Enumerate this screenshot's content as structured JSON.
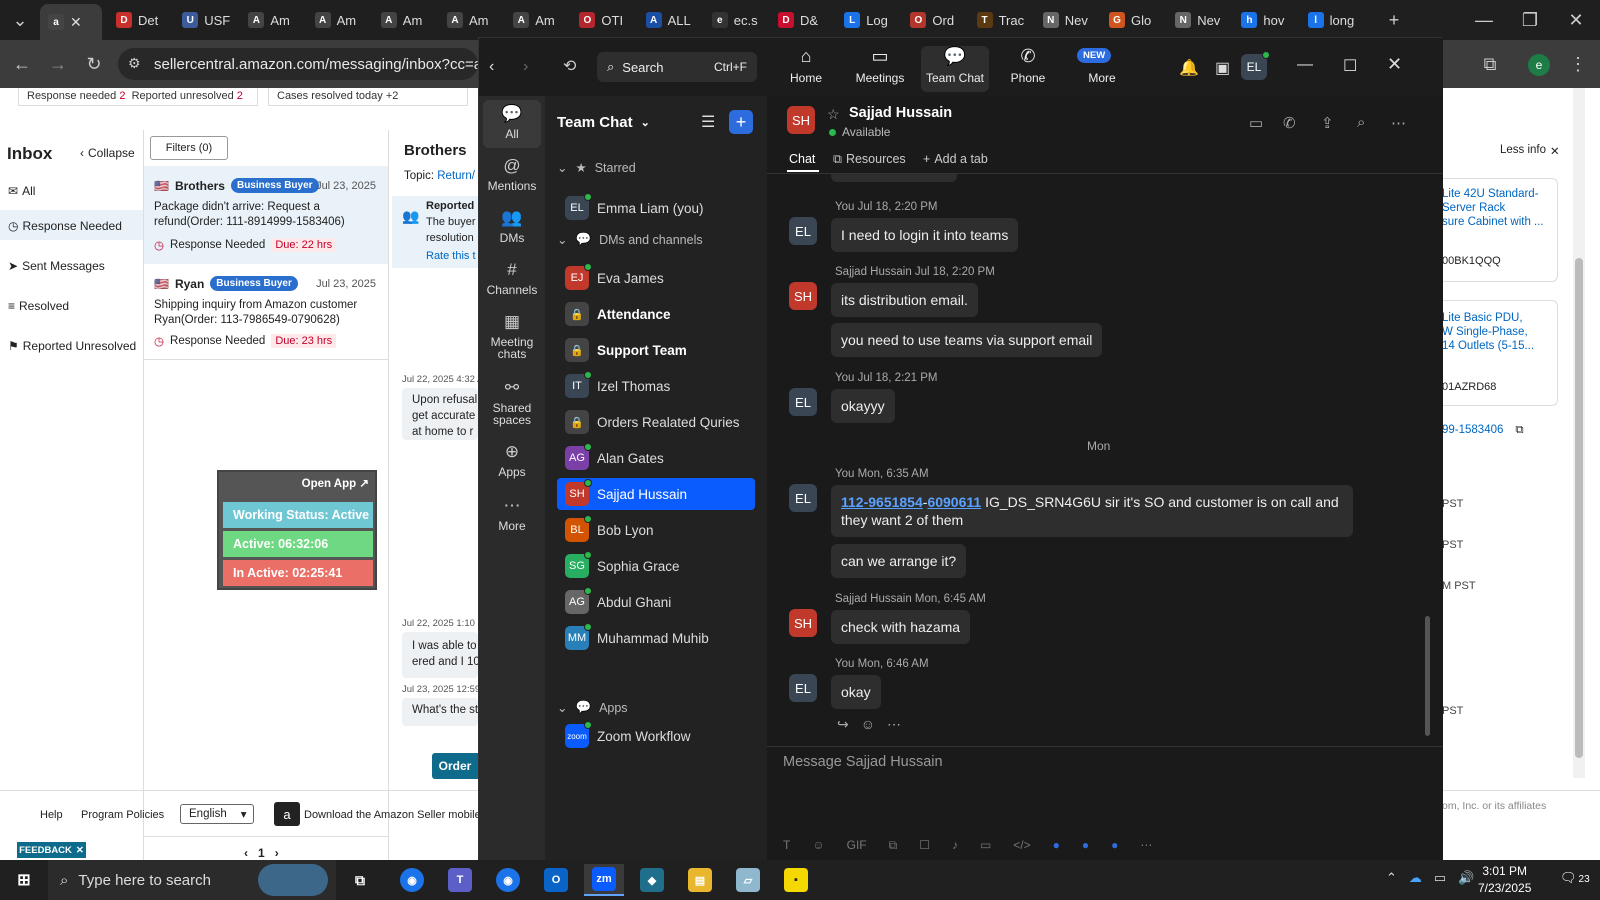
{
  "browser": {
    "tabs": [
      {
        "label": "Det",
        "icon": "store-icon",
        "color": "#c9302c"
      },
      {
        "label": "USF",
        "icon": "flag-icon",
        "color": "#3b5b9a"
      },
      {
        "label": "Am",
        "icon": "amazon-icon",
        "color": "#444"
      },
      {
        "label": "Am",
        "icon": "amazon-icon",
        "color": "#444"
      },
      {
        "label": "Am",
        "icon": "amazon-icon",
        "color": "#444"
      },
      {
        "label": "Am",
        "icon": "amazon-icon",
        "color": "#444"
      },
      {
        "label": "Am",
        "icon": "amazon-icon",
        "color": "#444"
      },
      {
        "label": "OTI",
        "icon": "truck-icon",
        "color": "#b3262c"
      },
      {
        "label": "ALL",
        "icon": "ti-icon",
        "color": "#1b4fa3"
      },
      {
        "label": "ec.s",
        "icon": "ec-icon",
        "color": "#333"
      },
      {
        "label": "D&",
        "icon": "dell-icon",
        "color": "#c8102e"
      },
      {
        "label": "Log",
        "icon": "google-icon",
        "color": "#1a73e8"
      },
      {
        "label": "Ord",
        "icon": "ord-icon",
        "color": "#b3352c"
      },
      {
        "label": "Trac",
        "icon": "ups-icon",
        "color": "#5b3a12"
      },
      {
        "label": "Nev",
        "icon": "globe-icon",
        "color": "#666"
      },
      {
        "label": "Glo",
        "icon": "glo-icon",
        "color": "#d0541f"
      },
      {
        "label": "Nev",
        "icon": "globe-icon",
        "color": "#666"
      },
      {
        "label": "hov",
        "icon": "google-icon",
        "color": "#1a73e8"
      },
      {
        "label": "long",
        "icon": "google-icon",
        "color": "#1a73e8"
      }
    ],
    "url": "sellercentral.amazon.com/messaging/inbox?cc=aa2",
    "profile_letter": "e"
  },
  "seller": {
    "stats": {
      "response_needed": "Response needed",
      "response_needed_n": "2",
      "reported_unresolved": "Reported unresolved",
      "reported_unresolved_n": "2",
      "cases_resolved": "Cases resolved today",
      "cases_resolved_n": "+2"
    },
    "inbox_title": "Inbox",
    "collapse": "Collapse",
    "filters": "Filters (0)",
    "nav": [
      "All",
      "Response Needed",
      "Sent Messages",
      "Resolved",
      "Reported Unresolved"
    ],
    "threads": [
      {
        "name": "Brothers",
        "badge": "Business Buyer",
        "date": "Jul 23, 2025",
        "subject": "Package didn't arrive: Request a refund(Order: 111-8914999-1583406)",
        "status": "Response Needed",
        "due": "Due: 22 hrs"
      },
      {
        "name": "Ryan",
        "badge": "Business Buyer",
        "date": "Jul 23, 2025",
        "subject": "Shipping inquiry from Amazon customer Ryan(Order: 113-7986549-0790628)",
        "status": "Response Needed",
        "due": "Due: 23 hrs"
      }
    ],
    "pager": "1",
    "conv_title": "Brothers",
    "topic_label": "Topic:",
    "topic": "Return/",
    "reported_title": "Reported",
    "reported_l1": "The buyer",
    "reported_l2": "resolution",
    "rate": "Rate this t",
    "msg1_time": "Jul 22, 2025 4:32 A",
    "msg1": [
      "Upon refusal",
      "get accurate",
      "at home to r"
    ],
    "msg2_time": "Jul 22, 2025 1:10 P",
    "msg2": [
      "I was able to",
      "ered and I 10"
    ],
    "msg3_time": "Jul 23, 2025 12:59",
    "msg3": "What's the st",
    "order_btn": "Order",
    "right_panel": {
      "less_info": "Less info",
      "p1": [
        "Lite 42U Standard-",
        "Server Rack",
        "sure Cabinet with ..."
      ],
      "p1_asin": "00BK1QQQ",
      "p2": [
        "Lite Basic PDU,",
        "W Single-Phase,",
        "14 Outlets (5-15..."
      ],
      "p2_asin": "01AZRD68",
      "order": "99-1583406",
      "pst": [
        "PST",
        "PST",
        "M PST",
        "PST"
      ],
      "copyright": "om, Inc. or its affiliates"
    },
    "footer": {
      "help": "Help",
      "policies": "Program Policies",
      "language": "English",
      "download": "Download the Amazon Seller mobile",
      "feedback": "FEEDBACK"
    }
  },
  "status_widget": {
    "open_app": "Open App",
    "working": "Working Status: Active",
    "active": "Active: 06:32:06",
    "inactive": "In Active: 02:25:41"
  },
  "zoom": {
    "search": "Search",
    "search_shortcut": "Ctrl+F",
    "nav": [
      {
        "label": "Home",
        "icon": "home-icon"
      },
      {
        "label": "Meetings",
        "icon": "video-icon"
      },
      {
        "label": "Team Chat",
        "icon": "chat-icon"
      },
      {
        "label": "Phone",
        "icon": "phone-icon"
      },
      {
        "label": "More",
        "icon": "more-icon"
      }
    ],
    "new_badge": "NEW",
    "user_initials": "EL",
    "rail": [
      {
        "label": "All",
        "icon": "chat-bubble-icon"
      },
      {
        "label": "Mentions",
        "icon": "at-icon"
      },
      {
        "label": "DMs",
        "icon": "people-icon"
      },
      {
        "label": "Channels",
        "icon": "hash-icon"
      },
      {
        "label": "Meeting chats",
        "icon": "calendar-icon"
      },
      {
        "label": "Shared spaces",
        "icon": "share-icon"
      },
      {
        "label": "Apps",
        "icon": "apps-icon"
      },
      {
        "label": "More",
        "icon": "ellipsis-icon"
      }
    ],
    "list_title": "Team Chat",
    "starred": "Starred",
    "dms_channels": "DMs and channels",
    "apps": "Apps",
    "contacts": [
      {
        "name": "Emma Liam (you)",
        "initials": "EL",
        "color": "#3a4654",
        "bold": false
      },
      {
        "name": "Eva James",
        "initials": "EJ",
        "color": "#c0392b",
        "bold": false
      },
      {
        "name": "Attendance",
        "initials": "🔒",
        "color": "#444",
        "bold": true
      },
      {
        "name": "Support Team",
        "initials": "🔒",
        "color": "#444",
        "bold": true
      },
      {
        "name": "Izel Thomas",
        "initials": "IT",
        "color": "#3a4654",
        "bold": false
      },
      {
        "name": "Orders Realated Quries",
        "initials": "🔒",
        "color": "#444",
        "bold": false
      },
      {
        "name": "Alan Gates",
        "initials": "AG",
        "color": "#7b3fa8",
        "bold": false
      },
      {
        "name": "Sajjad Hussain",
        "initials": "SH",
        "color": "#c0392b",
        "bold": false
      },
      {
        "name": "Bob Lyon",
        "initials": "BL",
        "color": "#d35400",
        "bold": false
      },
      {
        "name": "Sophia Grace",
        "initials": "SG",
        "color": "#27ae60",
        "bold": false
      },
      {
        "name": "Abdul Ghani",
        "initials": "AG",
        "color": "#666",
        "bold": false
      },
      {
        "name": "Muhammad Muhib",
        "initials": "MM",
        "color": "#2980b9",
        "bold": false
      }
    ],
    "app_item": {
      "name": "Zoom Workflow",
      "initials": "zoom"
    },
    "chat": {
      "contact_name": "Sajjad Hussain",
      "contact_initials": "SH",
      "presence": "Available",
      "tab_chat": "Chat",
      "tab_resources": "Resources",
      "tab_add": "Add a tab",
      "day_divider": "Mon",
      "messages": [
        {
          "who": "EL",
          "meta": "You Jul 18, 2:20 PM",
          "text": "I need to login it into teams"
        },
        {
          "who": "SH",
          "meta": "Sajjad Hussain Jul 18, 2:20 PM",
          "text": "its distribution email."
        },
        {
          "who": "",
          "meta": "",
          "text": "you need to use teams via support email"
        },
        {
          "who": "EL",
          "meta": "You Jul 18, 2:21 PM",
          "text": "okayyy"
        },
        {
          "who": "EL",
          "meta": "You Mon, 6:35 AM",
          "link1": "112-9651854",
          "link2": "6090611",
          "text": "IG_DS_SRN4G6U sir it's SO and customer is on call and they want 2 of them"
        },
        {
          "who": "",
          "meta": "",
          "text": "can we arrange it?"
        },
        {
          "who": "SH",
          "meta": "Sajjad Hussain Mon, 6:45 AM",
          "text": "check with hazama"
        },
        {
          "who": "EL",
          "meta": "You Mon, 6:46 AM",
          "text": "okay"
        }
      ],
      "compose_placeholder": "Message Sajjad Hussain"
    }
  },
  "taskbar": {
    "search_placeholder": "Type here to search",
    "time": "3:01 PM",
    "date": "7/23/2025",
    "notif_count": "23"
  }
}
